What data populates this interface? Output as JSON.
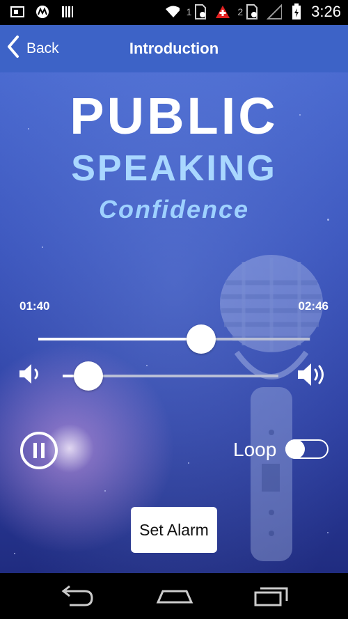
{
  "status_bar": {
    "time": "3:26",
    "sim1_label": "1",
    "sim2_label": "2",
    "icons": [
      "screenshot-icon",
      "motorola-icon",
      "barcode-icon",
      "wifi-icon",
      "sim-icon",
      "alert-icon",
      "signal-icon",
      "battery-icon"
    ]
  },
  "action_bar": {
    "back_label": "Back",
    "title": "Introduction"
  },
  "hero": {
    "line1": "PUBLIC",
    "line2": "SPEAKING",
    "line3": "Confidence"
  },
  "player": {
    "elapsed": "01:40",
    "total": "02:46",
    "progress_fraction": 0.6,
    "volume_fraction": 0.12,
    "loop_label": "Loop",
    "loop_enabled": false,
    "alarm_label": "Set Alarm"
  },
  "colors": {
    "action_bar": "#3d63c7",
    "title_accent": "#a9d7ff"
  }
}
